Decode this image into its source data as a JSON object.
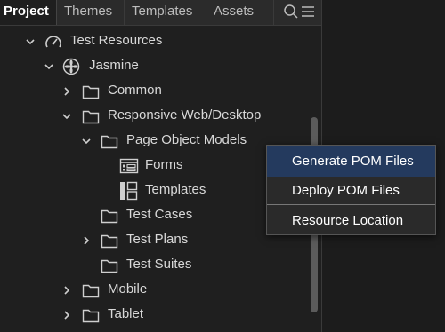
{
  "tabs": [
    {
      "label": "Project",
      "active": true
    },
    {
      "label": "Themes",
      "active": false
    },
    {
      "label": "Templates",
      "active": false
    },
    {
      "label": "Assets",
      "active": false
    }
  ],
  "toolbar_icons": [
    "search-icon",
    "menu-icon"
  ],
  "tree": {
    "items": [
      {
        "label": "Test Resources",
        "expanded": true,
        "icon": "speedometer-icon"
      },
      {
        "label": "Jasmine",
        "expanded": true,
        "icon": "jasmine-flower-icon"
      },
      {
        "label": "Common",
        "expanded": false,
        "icon": "folder-icon"
      },
      {
        "label": "Responsive Web/Desktop",
        "expanded": true,
        "icon": "folder-icon"
      },
      {
        "label": "Page Object Models",
        "expanded": true,
        "icon": "folder-icon"
      },
      {
        "label": "Forms",
        "icon": "form-icon"
      },
      {
        "label": "Templates",
        "icon": "template-icon"
      },
      {
        "label": "Test Cases",
        "icon": "folder-icon"
      },
      {
        "label": "Test Plans",
        "expanded": false,
        "icon": "folder-icon"
      },
      {
        "label": "Test Suites",
        "icon": "folder-icon"
      },
      {
        "label": "Mobile",
        "expanded": false,
        "icon": "folder-icon"
      },
      {
        "label": "Tablet",
        "expanded": false,
        "icon": "folder-icon"
      }
    ]
  },
  "context_menu": {
    "items": [
      {
        "label": "Generate POM Files",
        "highlighted": true
      },
      {
        "label": "Deploy POM Files",
        "highlighted": false
      },
      {
        "label": "Resource Location",
        "highlighted": false
      }
    ]
  },
  "colors": {
    "background": "#1f1f1f",
    "tab_bar": "#2b2b2b",
    "menu_highlight": "#243a5e",
    "text": "#d8d8d8"
  }
}
